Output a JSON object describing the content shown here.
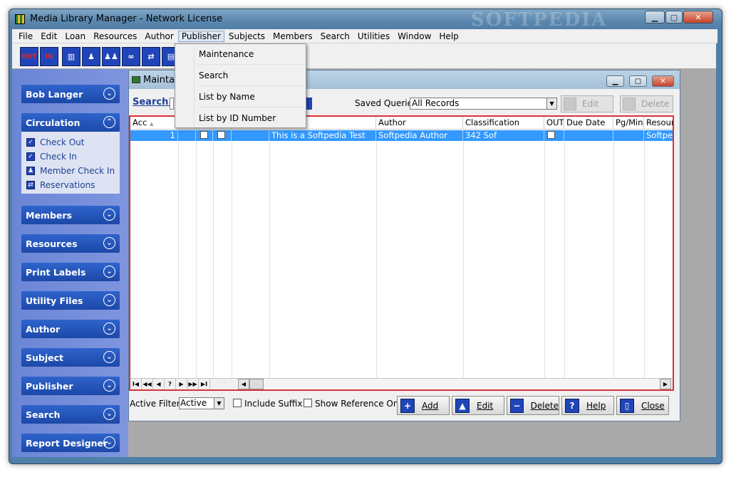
{
  "window": {
    "title": "Media Library Manager - Network License",
    "watermark": "SOFTPEDIA"
  },
  "menubar": [
    "File",
    "Edit",
    "Loan",
    "Resources",
    "Author",
    "Publisher",
    "Subjects",
    "Members",
    "Search",
    "Utilities",
    "Window",
    "Help"
  ],
  "toolbar": {
    "out_label": "OUT",
    "in_label": "IN"
  },
  "publisher_menu": [
    "Maintenance",
    "Search",
    "List by Name",
    "List by ID Number"
  ],
  "explorer": {
    "user": "Bob Langer",
    "circulation": "Circulation",
    "circulation_items": [
      "Check Out",
      "Check In",
      "Member Check In",
      "Reservations"
    ],
    "groups": [
      "Members",
      "Resources",
      "Print Labels",
      "Utility Files",
      "Author",
      "Subject",
      "Publisher",
      "Search",
      "Report Designer"
    ]
  },
  "child": {
    "title": "Maintai",
    "search_label": "Search:",
    "saved_queries_label": "Saved Queries:",
    "saved_queries_value": "All Records",
    "edit_disabled": "Edit",
    "delete_disabled": "Delete"
  },
  "grid": {
    "headers": [
      "Acc",
      "",
      "",
      "",
      "",
      "Author",
      "Classification",
      "OUT",
      "Due Date",
      "Pg/Min",
      "Resourc"
    ],
    "row": {
      "acc": "1",
      "title": "This is a Softpedia Test",
      "author": "Softpedia Author",
      "classification": "342 Sof",
      "resource": "Softpedia"
    },
    "nav": [
      "I◀",
      "◀◀",
      "◀",
      "?",
      "▶",
      "▶▶",
      "▶I"
    ]
  },
  "bottom": {
    "active_filter_label": "Active Filter:",
    "active_filter_value": "Active",
    "include_suffix": "Include Suffix",
    "show_reference_only": "Show Reference Only",
    "add": "Add",
    "edit": "Edit",
    "delete": "Delete",
    "help": "Help",
    "close": "Close"
  }
}
